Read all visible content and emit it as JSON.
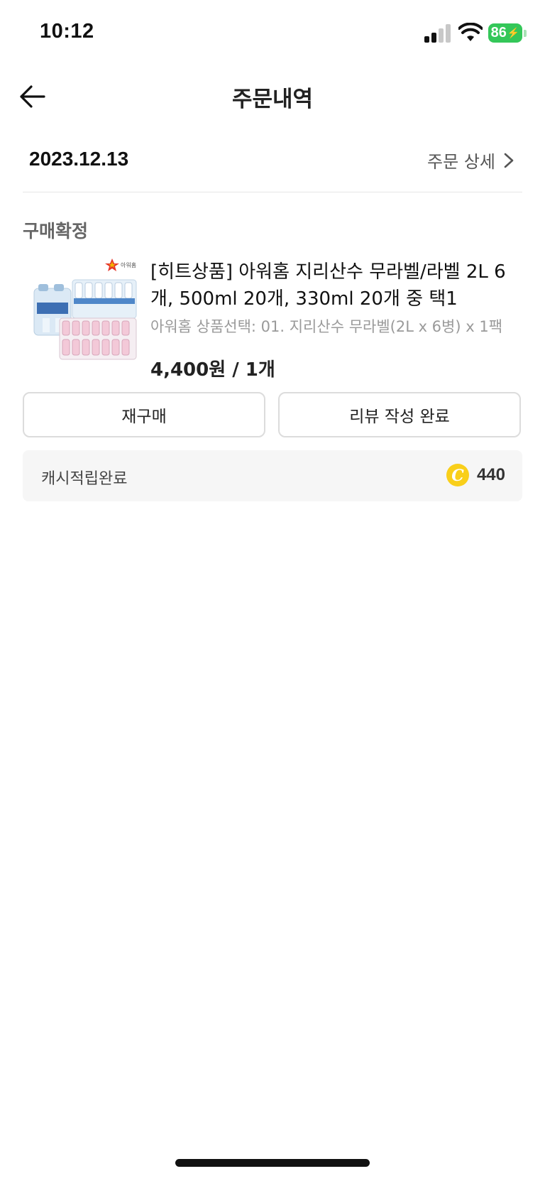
{
  "status_bar": {
    "time": "10:12",
    "battery": "86"
  },
  "header": {
    "title": "주문내역"
  },
  "order": {
    "date": "2023.12.13",
    "detail_link": "주문 상세",
    "status": "구매확정"
  },
  "product": {
    "brand_logo_text": "아워홈",
    "name": "[히트상품] 아워홈 지리산수 무라벨/라벨 2L 6개, 500ml 20개, 330ml 20개 중 택1",
    "option": "아워홈 상품선택: 01. 지리산수 무라벨(2L x 6병) x 1팩",
    "price": "4,400원 / 1개"
  },
  "actions": {
    "repurchase": "재구매",
    "review": "리뷰 작성 완료"
  },
  "cash": {
    "label": "캐시적립완료",
    "amount": "440",
    "coin_color": "#f9cf1a"
  },
  "colors": {
    "battery": "#34c759"
  }
}
